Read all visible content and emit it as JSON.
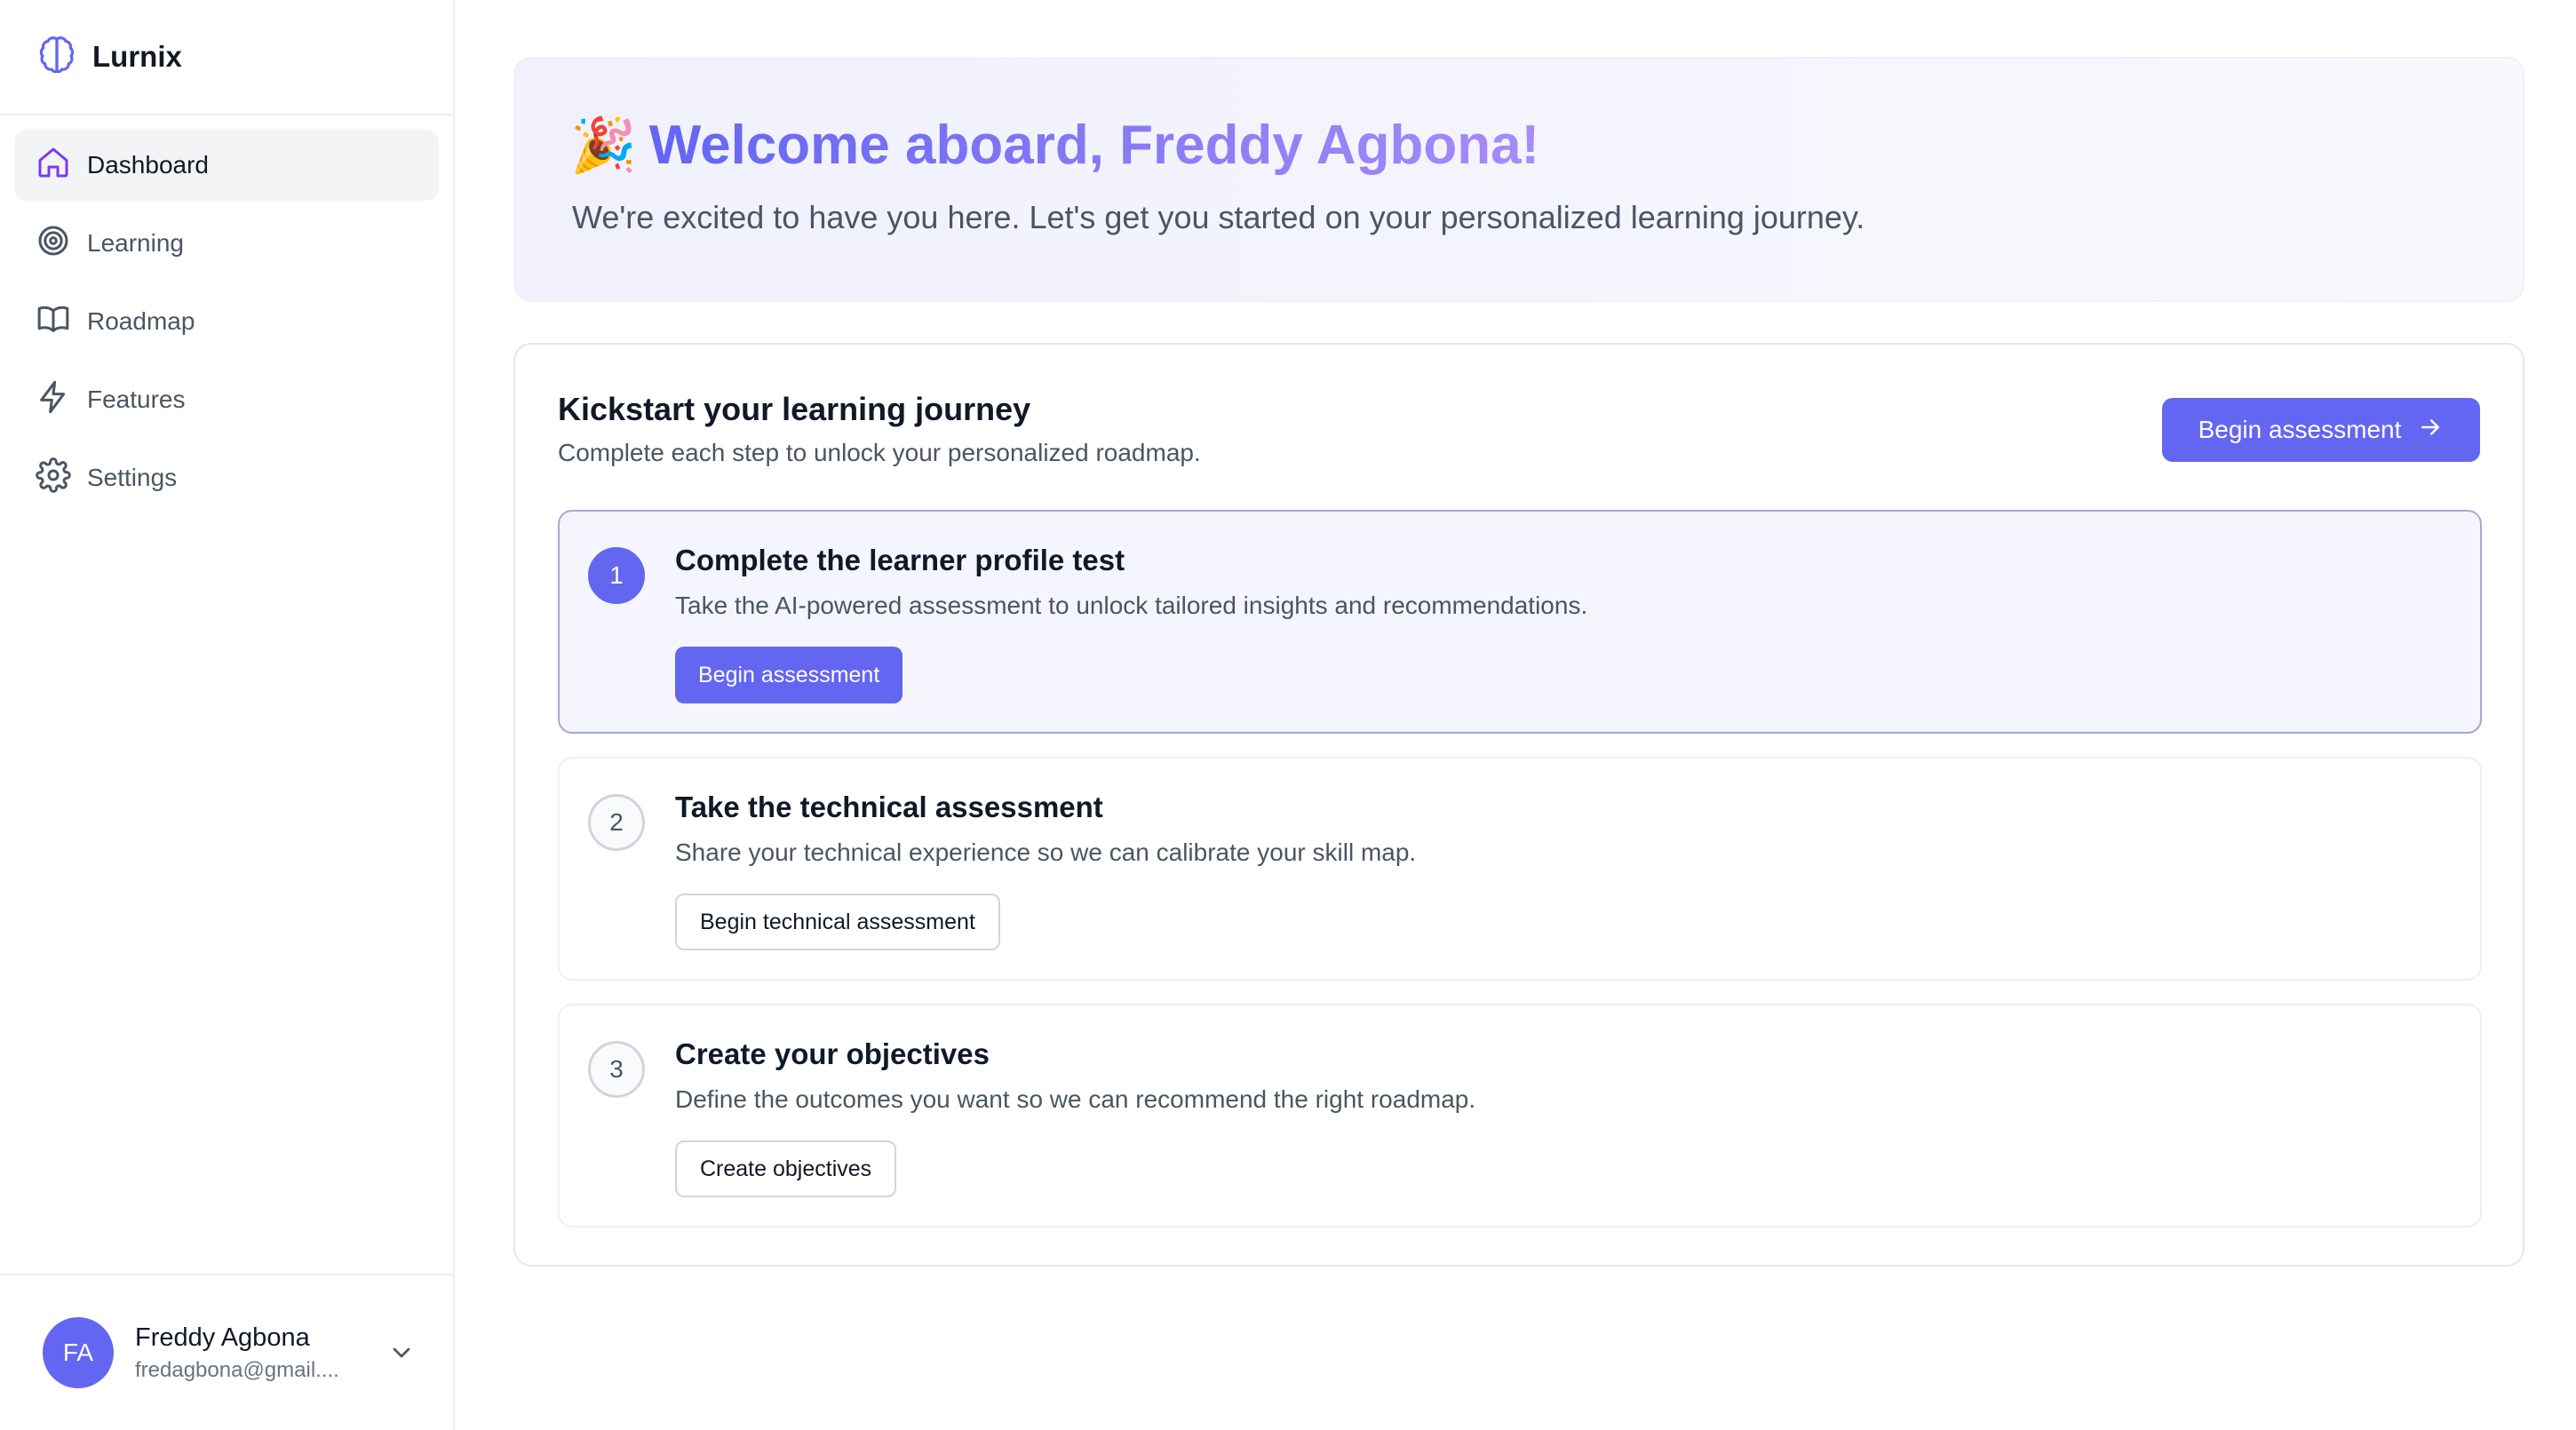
{
  "app": {
    "name": "Lurnix"
  },
  "sidebar": {
    "items": [
      {
        "label": "Dashboard",
        "icon": "home-icon",
        "active": true
      },
      {
        "label": "Learning",
        "icon": "target-icon",
        "active": false
      },
      {
        "label": "Roadmap",
        "icon": "book-icon",
        "active": false
      },
      {
        "label": "Features",
        "icon": "lightning-icon",
        "active": false
      },
      {
        "label": "Settings",
        "icon": "gear-icon",
        "active": false
      }
    ]
  },
  "user": {
    "initials": "FA",
    "name": "Freddy Agbona",
    "email": "fredagbona@gmail...."
  },
  "hero": {
    "emoji": "🎉",
    "title": "Welcome aboard, Freddy Agbona!",
    "subtitle": "We're excited to have you here. Let's get you started on your personalized learning journey."
  },
  "journey": {
    "title": "Kickstart your learning journey",
    "subtitle": "Complete each step to unlock your personalized roadmap.",
    "primary_button": "Begin assessment",
    "steps": [
      {
        "number": "1",
        "title": "Complete the learner profile test",
        "description": "Take the AI-powered assessment to unlock tailored insights and recommendations.",
        "button": "Begin assessment",
        "active": true
      },
      {
        "number": "2",
        "title": "Take the technical assessment",
        "description": "Share your technical experience so we can calibrate your skill map.",
        "button": "Begin technical assessment",
        "active": false
      },
      {
        "number": "3",
        "title": "Create your objectives",
        "description": "Define the outcomes you want so we can recommend the right roadmap.",
        "button": "Create objectives",
        "active": false
      }
    ]
  },
  "colors": {
    "accent": "#6366f1",
    "accent_light": "#a78bfa"
  }
}
